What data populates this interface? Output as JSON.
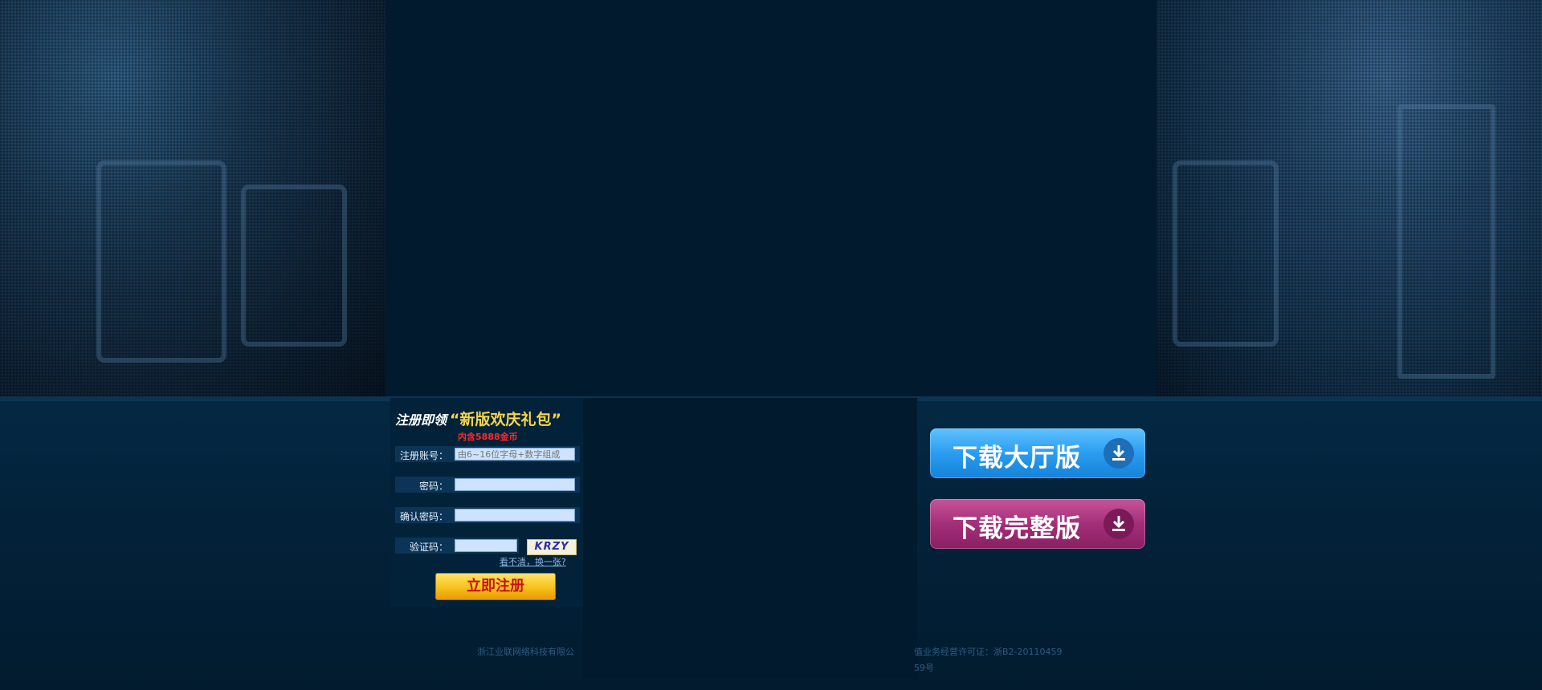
{
  "registration": {
    "title_prefix": "注册即领",
    "title_highlight": "“新版欢庆礼包”",
    "subtitle": "内含5888金币",
    "account_label": "注册账号：",
    "account_placeholder": "由6~16位字母+数字组成",
    "password_label": "密码：",
    "confirm_password_label": "确认密码：",
    "captcha_label": "验证码：",
    "captcha_text": "KRZY",
    "refresh_link": "看不清，换一张?",
    "submit_label": "立即注册"
  },
  "downloads": {
    "hall_label": "下载大厅版",
    "full_label": "下载完整版",
    "hall_color": "#2a9cf0",
    "full_color": "#a22f78",
    "icon": "download-arrow-icon"
  },
  "footer": {
    "company_fragment": "浙江业联网络科技有限公",
    "license_fragment": "值业务经营许可证：浙B2-20110459",
    "record_fragment": "59号"
  }
}
